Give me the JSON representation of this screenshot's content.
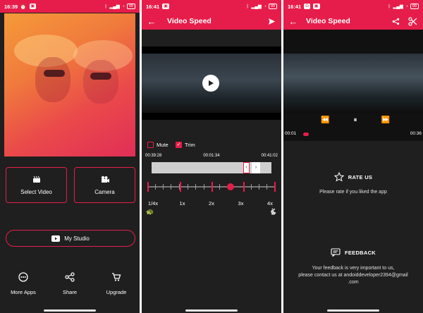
{
  "colors": {
    "accent": "#e61d4a",
    "background": "#1f1f1f"
  },
  "screens": [
    {
      "status": {
        "time": "16:39",
        "battery": "99"
      },
      "select_video": "Select Video",
      "camera": "Camera",
      "my_studio": "My Studio",
      "nav": [
        {
          "label": "More Apps",
          "icon": "more-apps-icon"
        },
        {
          "label": "Share",
          "icon": "share-icon"
        },
        {
          "label": "Upgrade",
          "icon": "cart-icon"
        }
      ]
    },
    {
      "status": {
        "time": "16:41",
        "battery": "99"
      },
      "title": "Video Speed",
      "mute": "Mute",
      "trim": "Trim",
      "times": [
        "00:39:28",
        "00:01:34",
        "00:41:02"
      ],
      "speeds": [
        "1/4x",
        "1x",
        "2x",
        "3x",
        "4x"
      ],
      "speed_selected": "3x"
    },
    {
      "status": {
        "time": "16:41",
        "battery": "99"
      },
      "title": "Video Speed",
      "current_time": "00:01",
      "total_time": "00:36",
      "rate_title": "RATE US",
      "rate_text": "Please rate if you liked the app",
      "feedback_title": "FEEDBACK",
      "feedback_line1": "Your feedback is very important to us,",
      "feedback_line2": "please contact us at andoiddeveloper2394@gmail",
      "feedback_line3": ".com"
    }
  ]
}
